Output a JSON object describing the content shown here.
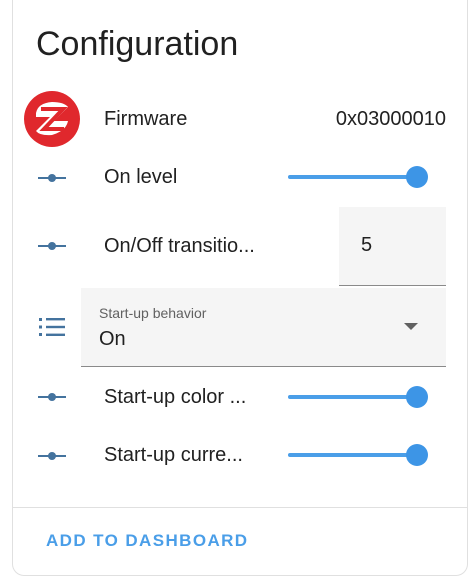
{
  "card": {
    "title": "Configuration",
    "rows": [
      {
        "icon": "zigbee-logo-icon",
        "label": "Firmware",
        "value": "0x03000010"
      },
      {
        "icon": "slider-handle-icon",
        "label": "On level",
        "slider_value": 1.0
      },
      {
        "icon": "slider-handle-icon",
        "label": "On/Off transitio...",
        "number_value": "5"
      },
      {
        "icon": "list-icon",
        "select_label": "Start-up behavior",
        "select_value": "On"
      },
      {
        "icon": "slider-handle-icon",
        "label": "Start-up color ...",
        "slider_value": 1.0
      },
      {
        "icon": "slider-handle-icon",
        "label": "Start-up curre...",
        "slider_value": 1.0
      }
    ],
    "footer": {
      "add_button_label": "ADD TO DASHBOARD"
    }
  },
  "colors": {
    "accent": "#3d95e6",
    "icon": "#44739e",
    "zigbee_red": "#e0282d",
    "field_bg": "#f5f5f5"
  }
}
